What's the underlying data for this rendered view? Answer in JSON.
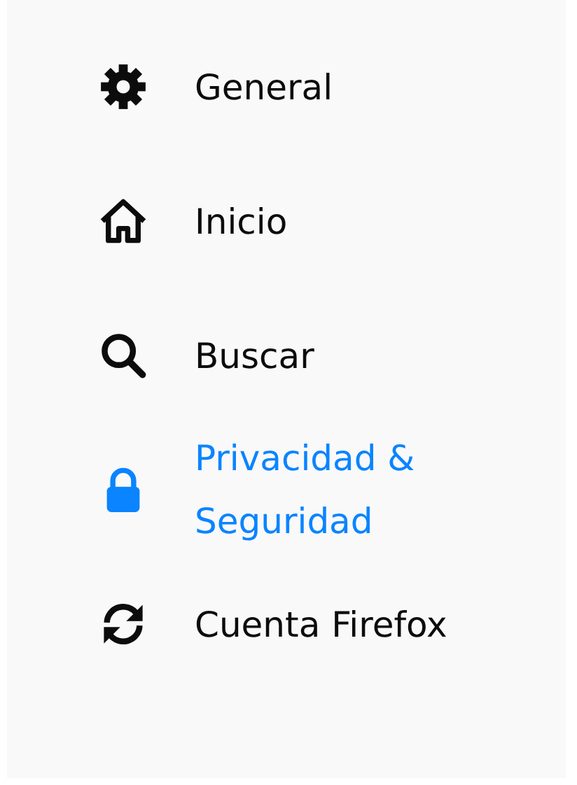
{
  "sidebar": {
    "items": [
      {
        "label": "General",
        "selected": false
      },
      {
        "label": "Inicio",
        "selected": false
      },
      {
        "label": "Buscar",
        "selected": false
      },
      {
        "label": "Privacidad & Seguridad",
        "selected": true
      },
      {
        "label": "Cuenta Firefox",
        "selected": false
      }
    ]
  }
}
